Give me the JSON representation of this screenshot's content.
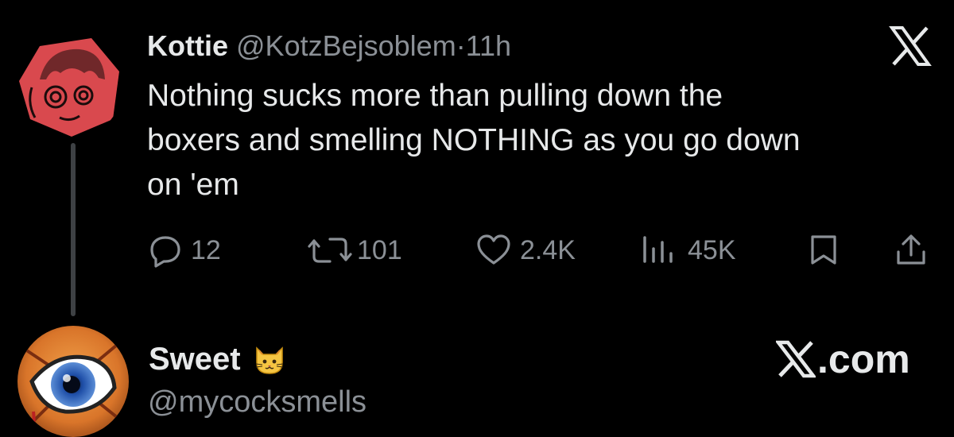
{
  "tweet": {
    "author_name": "Kottie",
    "author_handle": "@KotzBejsoblem",
    "separator": "·",
    "time": "11h",
    "text_line1": "Nothing sucks more than pulling down the",
    "text_line2": "boxers and smelling NOTHING as you go down",
    "text_line3": "on 'em",
    "actions": {
      "replies": "12",
      "reposts": "101",
      "likes": "2.4K",
      "views": "45K"
    }
  },
  "reply": {
    "author_name": "Sweet",
    "author_emoji": "🐱",
    "author_handle": "@mycocksmells"
  },
  "watermark": {
    "x_logo_text": "X",
    "domain_suffix": ".com"
  },
  "colors": {
    "background": "#000000",
    "primary_text": "#e7e9ea",
    "secondary_text": "#8b9096",
    "avatar1_red": "#d9494e",
    "thread_line": "#3e4144"
  },
  "icons": [
    "reply-icon",
    "repost-icon",
    "like-icon",
    "views-icon",
    "bookmark-icon",
    "share-icon",
    "x-logo-icon"
  ]
}
